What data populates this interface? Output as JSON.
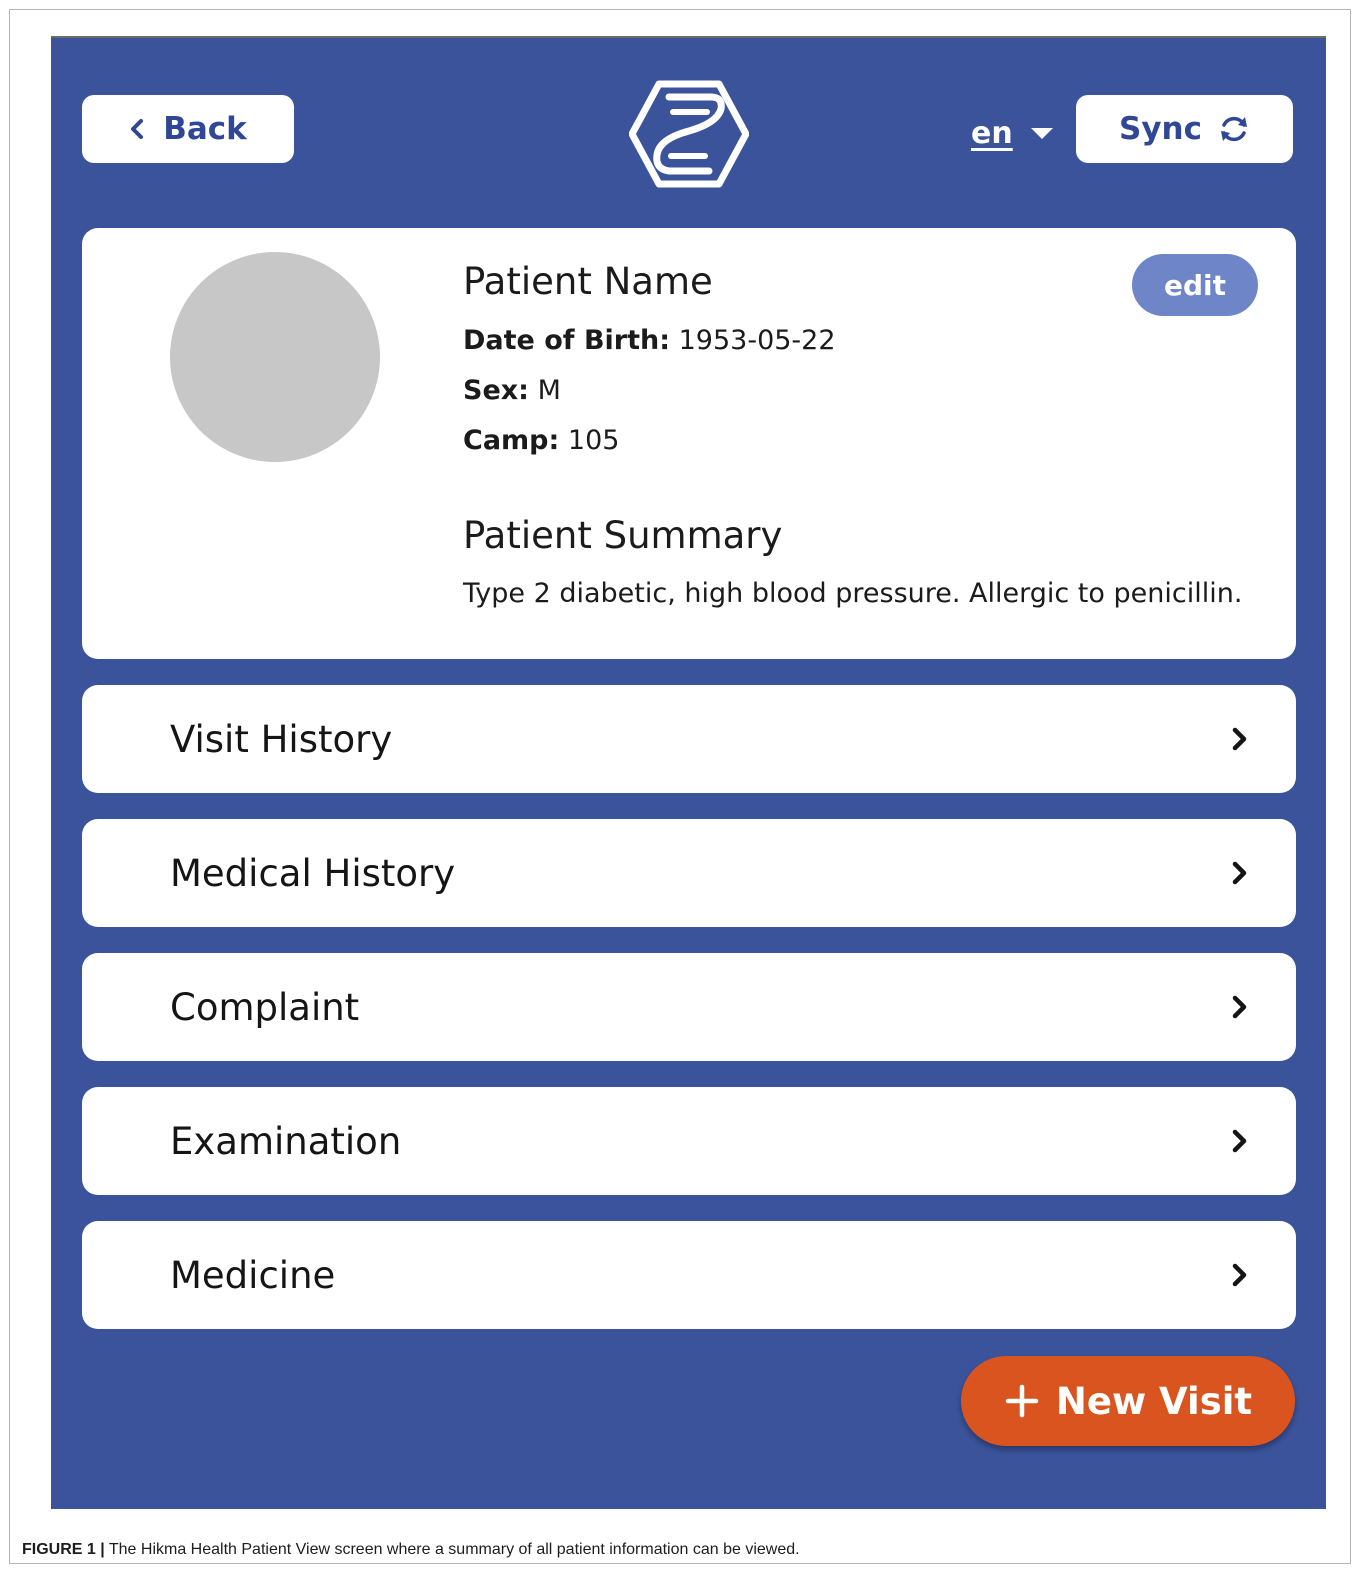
{
  "header": {
    "back_label": "Back",
    "lang_label": "en",
    "sync_label": "Sync"
  },
  "patient": {
    "name": "Patient Name",
    "edit_label": "edit",
    "dob_key": "Date of Birth:",
    "dob_value": "1953-05-22",
    "sex_key": "Sex:",
    "sex_value": "M",
    "camp_key": "Camp:",
    "camp_value": "105",
    "summary_title": "Patient Summary",
    "summary_text": "Type 2 diabetic, high blood pressure. Allergic to penicillin."
  },
  "sections": [
    {
      "label": "Visit History"
    },
    {
      "label": "Medical History"
    },
    {
      "label": "Complaint"
    },
    {
      "label": "Examination"
    },
    {
      "label": "Medicine"
    }
  ],
  "fab": {
    "new_visit_label": "New Visit"
  },
  "caption": {
    "label": "FIGURE 1 |",
    "text": "The Hikma Health Patient View screen where a summary of all patient information can be viewed."
  },
  "colors": {
    "background": "#3a539b",
    "accent_blue": "#2f4796",
    "edit_button": "#6e86c8",
    "new_visit_button": "#d9541e",
    "avatar_placeholder": "#c7c7c7"
  },
  "icons": {
    "back": "chevron-left-icon",
    "lang": "caret-down-icon",
    "sync": "sync-icon",
    "logo": "hikma-logo",
    "row": "chevron-right-icon",
    "fab": "plus-icon"
  }
}
